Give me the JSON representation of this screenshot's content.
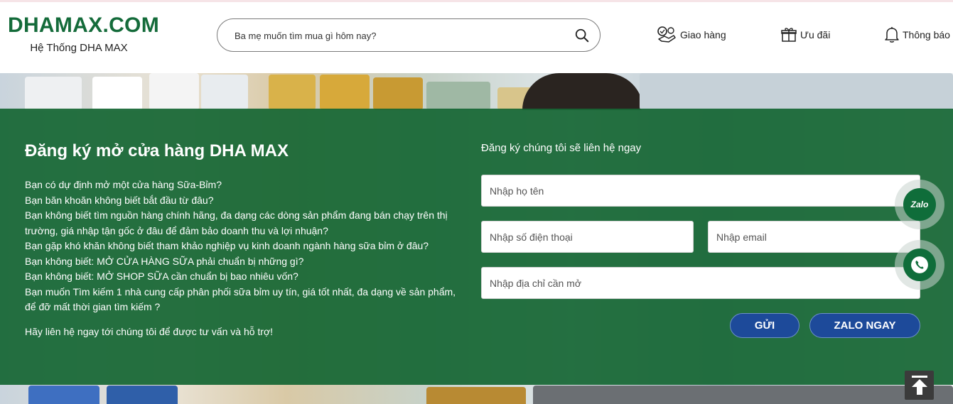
{
  "header": {
    "logo_title": "DHAMAX.COM",
    "logo_subtitle": "Hệ Thống DHA MAX",
    "search_placeholder": "Ba mẹ muốn tìm mua gì hôm nay?",
    "nav": [
      {
        "label": "Giao hàng",
        "icon": "delivery-icon"
      },
      {
        "label": "Ưu đãi",
        "icon": "gift-icon"
      },
      {
        "label": "Thông báo",
        "icon": "bell-icon"
      }
    ]
  },
  "register": {
    "title": "Đăng ký mở cửa hàng DHA MAX",
    "lines": [
      "Bạn có dự định mở một cửa hàng Sữa-Bỉm?",
      "Bạn băn khoăn không biết bắt đầu từ đâu?",
      "Bạn không biết tìm nguồn hàng chính hãng, đa dạng các dòng sản phẩm đang bán chạy trên thị trường, giá nhập tận gốc ở đâu để đảm bảo doanh thu và lợi nhuận?",
      "Bạn gặp khó khăn không biết tham khảo nghiệp vụ kinh doanh ngành hàng sữa bỉm ở đâu?",
      "Bạn không biết: MỞ CỬA HÀNG SỮA phải chuẩn bị những gì?",
      "Bạn không biết: MỞ SHOP SỮA cần chuẩn bị bao nhiêu vốn?",
      "Bạn muốn Tìm kiếm 1 nhà cung cấp phân phối sữa bỉm uy tín, giá tốt nhất, đa dạng về sản phẩm, để đỡ mất thời gian tìm kiếm ?"
    ],
    "cta": "Hãy liên hệ ngay tới chúng tôi để được tư vấn và hỗ trợ!"
  },
  "form": {
    "subtitle": "Đăng ký chúng tôi sẽ liên hệ ngay",
    "name_placeholder": "Nhập họ tên",
    "phone_placeholder": "Nhập số điện thoại",
    "email_placeholder": "Nhập email",
    "address_placeholder": "Nhập địa chỉ cần mở",
    "submit_label": "GỬI",
    "zalo_label": "ZALO NGAY"
  },
  "floating": {
    "zalo_label": "Zalo"
  },
  "colors": {
    "brand_green": "#146b3a",
    "overlay_green": "#156634",
    "button_blue": "#1d4a9a"
  }
}
